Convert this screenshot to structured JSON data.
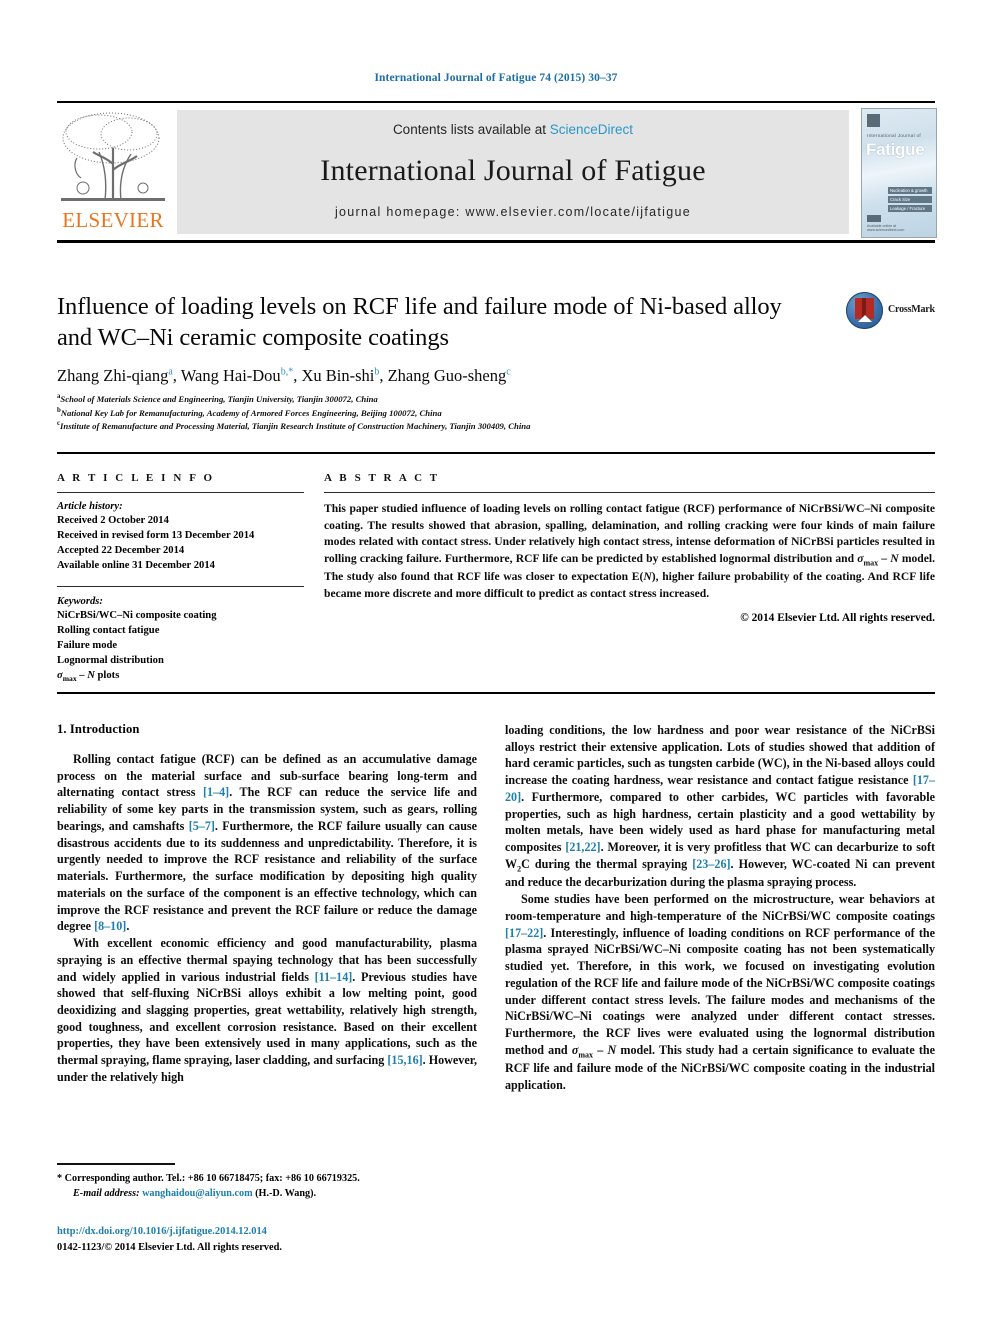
{
  "running_head": "International Journal of Fatigue 74 (2015) 30–37",
  "masthead": {
    "publisher_logo_text": "ELSEVIER",
    "contents_prefix": "Contents lists available at ",
    "contents_link": "ScienceDirect",
    "journal_name": "International Journal of Fatigue",
    "homepage": "journal homepage: www.elsevier.com/locate/ijfatigue",
    "cover": {
      "small_title": "International Journal of",
      "big_title": "Fatigue",
      "bars": [
        "Nucleation & growth",
        "Crack Size",
        "Leakage / Fracture"
      ],
      "footer_text": "Available online at www.sciencedirect.com"
    }
  },
  "article": {
    "title": "Influence of loading levels on RCF life and failure mode of Ni-based alloy and WC–Ni ceramic composite coatings",
    "crossmark_label": "CrossMark",
    "authors": [
      {
        "name": "Zhang Zhi-qiang",
        "marks": "a"
      },
      {
        "name": "Wang Hai-Dou",
        "marks": "b,*"
      },
      {
        "name": "Xu Bin-shi",
        "marks": "b"
      },
      {
        "name": "Zhang Guo-sheng",
        "marks": "c"
      }
    ],
    "affiliations": [
      {
        "mark": "a",
        "text": "School of Materials Science and Engineering, Tianjin University, Tianjin 300072, China"
      },
      {
        "mark": "b",
        "text": "National Key Lab for Remanufacturing, Academy of Armored Forces Engineering, Beijing 100072, China"
      },
      {
        "mark": "c",
        "text": "Institute of Remanufacture and Processing Material, Tianjin Research Institute of Construction Machinery, Tianjin 300409, China"
      }
    ]
  },
  "article_info": {
    "heading": "A R T I C L E   I N F O",
    "history_label": "Article history:",
    "history": [
      "Received 2 October 2014",
      "Received in revised form 13 December 2014",
      "Accepted 22 December 2014",
      "Available online 31 December 2014"
    ],
    "keywords_label": "Keywords:",
    "keywords": [
      "NiCrBSi/WC–Ni composite coating",
      "Rolling contact fatigue",
      "Failure mode",
      "Lognormal distribution",
      "σmax – N plots"
    ]
  },
  "abstract": {
    "heading": "A B S T R A C T",
    "text": "This paper studied influence of loading levels on rolling contact fatigue (RCF) performance of NiCrBSi/WC–Ni composite coating. The results showed that abrasion, spalling, delamination, and rolling cracking were four kinds of main failure modes related with contact stress. Under relatively high contact stress, intense deformation of NiCrBSi particles resulted in rolling cracking failure. Furthermore, RCF life can be predicted by established lognormal distribution and σmax – N model. The study also found that RCF life was closer to expectation E(N), higher failure probability of the coating. And RCF life became more discrete and more difficult to predict as contact stress increased.",
    "copyright": "© 2014 Elsevier Ltd. All rights reserved."
  },
  "body": {
    "section_heading": "1. Introduction",
    "left_paragraphs": [
      "Rolling contact fatigue (RCF) can be defined as an accumulative damage process on the material surface and sub-surface bearing long-term and alternating contact stress [1–4]. The RCF can reduce the service life and reliability of some key parts in the transmission system, such as gears, rolling bearings, and camshafts [5–7]. Furthermore, the RCF failure usually can cause disastrous accidents due to its suddenness and unpredictability. Therefore, it is urgently needed to improve the RCF resistance and reliability of the surface materials. Furthermore, the surface modification by depositing high quality materials on the surface of the component is an effective technology, which can improve the RCF resistance and prevent the RCF failure or reduce the damage degree [8–10].",
      "With excellent economic efficiency and good manufacturability, plasma spraying is an effective thermal spaying technology that has been successfully and widely applied in various industrial fields [11–14]. Previous studies have showed that self-fluxing NiCrBSi alloys exhibit a low melting point, good deoxidizing and slagging properties, great wettability, relatively high strength, good toughness, and excellent corrosion resistance. Based on their excellent properties, they have been extensively used in many applications, such as the thermal spraying, flame spraying, laser cladding, and surfacing [15,16]. However, under the relatively high"
    ],
    "right_paragraphs": [
      "loading conditions, the low hardness and poor wear resistance of the NiCrBSi alloys restrict their extensive application. Lots of studies showed that addition of hard ceramic particles, such as tungsten carbide (WC), in the Ni-based alloys could increase the coating hardness, wear resistance and contact fatigue resistance [17–20]. Furthermore, compared to other carbides, WC particles with favorable properties, such as high hardness, certain plasticity and a good wettability by molten metals, have been widely used as hard phase for manufacturing metal composites [21,22]. Moreover, it is very profitless that WC can decarburize to soft W2C during the thermal spraying [23–26]. However, WC-coated Ni can prevent and reduce the decarburization during the plasma spraying process.",
      "Some studies have been performed on the microstructure, wear behaviors at room-temperature and high-temperature of the NiCrBSi/WC composite coatings [17–22]. Interestingly, influence of loading conditions on RCF performance of the plasma sprayed NiCrBSi/WC–Ni composite coating has not been systematically studied yet. Therefore, in this work, we focused on investigating evolution regulation of the RCF life and failure mode of the NiCrBSi/WC composite coatings under different contact stress levels. The failure modes and mechanisms of the NiCrBSi/WC–Ni coatings were analyzed under different contact stresses. Furthermore, the RCF lives were evaluated using the lognormal distribution method and σmax – N model. This study had a certain significance to evaluate the RCF life and failure mode of the NiCrBSi/WC composite coating in the industrial application."
    ]
  },
  "footnote": {
    "corresponding": "* Corresponding author. Tel.: +86 10 66718475; fax: +86 10 66719325.",
    "email_label": "E-mail address:",
    "email": "wanghaidou@aliyun.com",
    "email_suffix": "(H.-D. Wang)."
  },
  "footer": {
    "doi": "http://dx.doi.org/10.1016/j.ijfatigue.2014.12.014",
    "issn_line": "0142-1123/© 2014 Elsevier Ltd. All rights reserved."
  },
  "colors": {
    "link": "#1c7fad",
    "sciencedirect": "#2b96c8",
    "elsevier_orange": "#e8761f",
    "running_head": "#1c6ea4"
  }
}
